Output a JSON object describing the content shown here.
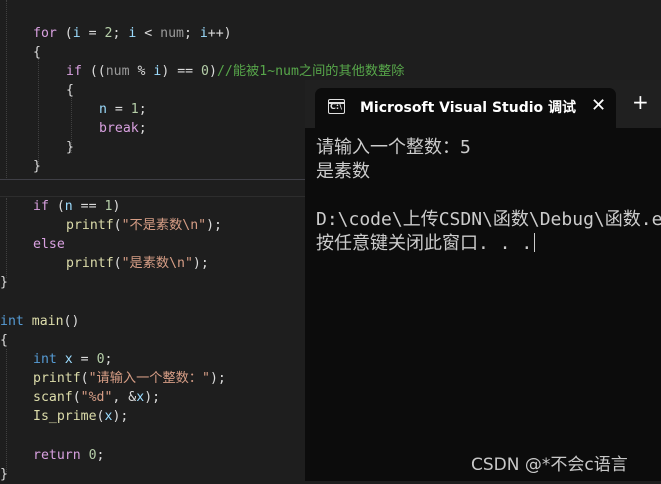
{
  "code": {
    "for_line": {
      "k_for": "for",
      "a": " (",
      "v_i1": "i",
      "b": " = ",
      "n2": "2",
      "c": "; ",
      "v_i2": "i",
      "d": " < ",
      "p_num": "num",
      "e": "; ",
      "v_i3": "i",
      "f": "++)"
    },
    "brace_open_1": "{",
    "if1_line": {
      "k_if": "if",
      "a": " ((",
      "p_num": "num",
      "b": " % ",
      "v_i": "i",
      "c": ") == ",
      "n0": "0",
      "d": ")",
      "comment": "//能被1~num之间的其他数整除"
    },
    "brace_open_2": "{",
    "assign_line": {
      "v_n": "n",
      "a": " = ",
      "n1": "1",
      "b": ";"
    },
    "break_line": {
      "k_break": "break",
      "a": ";"
    },
    "brace_close_2": "}",
    "brace_close_1": "}",
    "if2_line": {
      "k_if": "if",
      "a": " (",
      "v_n": "n",
      "b": " == ",
      "n1": "1",
      "c": ")"
    },
    "printf1_line": {
      "fn": "printf",
      "a": "(",
      "str": "\"不是素数\\n\"",
      "b": ");"
    },
    "else_line": "else",
    "printf2_line": {
      "fn": "printf",
      "a": "(",
      "str": "\"是素数\\n\"",
      "b": ");"
    },
    "brace_close_fn1": "}",
    "main_line": {
      "k_int": "int",
      "sp": " ",
      "fn": "main",
      "a": "()"
    },
    "brace_open_main": "{",
    "decl_line": {
      "k_int": "int",
      "a": " ",
      "v_x": "x",
      "b": " = ",
      "n0": "0",
      "c": ";"
    },
    "printf3_line": {
      "fn": "printf",
      "a": "(",
      "str": "\"请输入一个整数：\"",
      "b": ");"
    },
    "scanf_line": {
      "fn": "scanf",
      "a": "(",
      "str": "\"%d\"",
      "b": ", &",
      "v_x": "x",
      "c": ");"
    },
    "call_line": {
      "fn": "Is_prime",
      "a": "(",
      "v_x": "x",
      "b": ");"
    },
    "return_line": {
      "k_return": "return",
      "a": " ",
      "n0": "0",
      "b": ";"
    },
    "brace_close_main": "}"
  },
  "terminal": {
    "tab_title": "Microsoft Visual Studio 调试控制台",
    "icon_glyph": "C:\\",
    "close_glyph": "✕",
    "add_glyph": "+",
    "lines": [
      "请输入一个整数：5",
      "是素数",
      "D:\\code\\上传CSDN\\函数\\Debug\\函数.exe",
      "按任意键关闭此窗口. . ."
    ]
  },
  "watermark": "CSDN @*不会c语言"
}
